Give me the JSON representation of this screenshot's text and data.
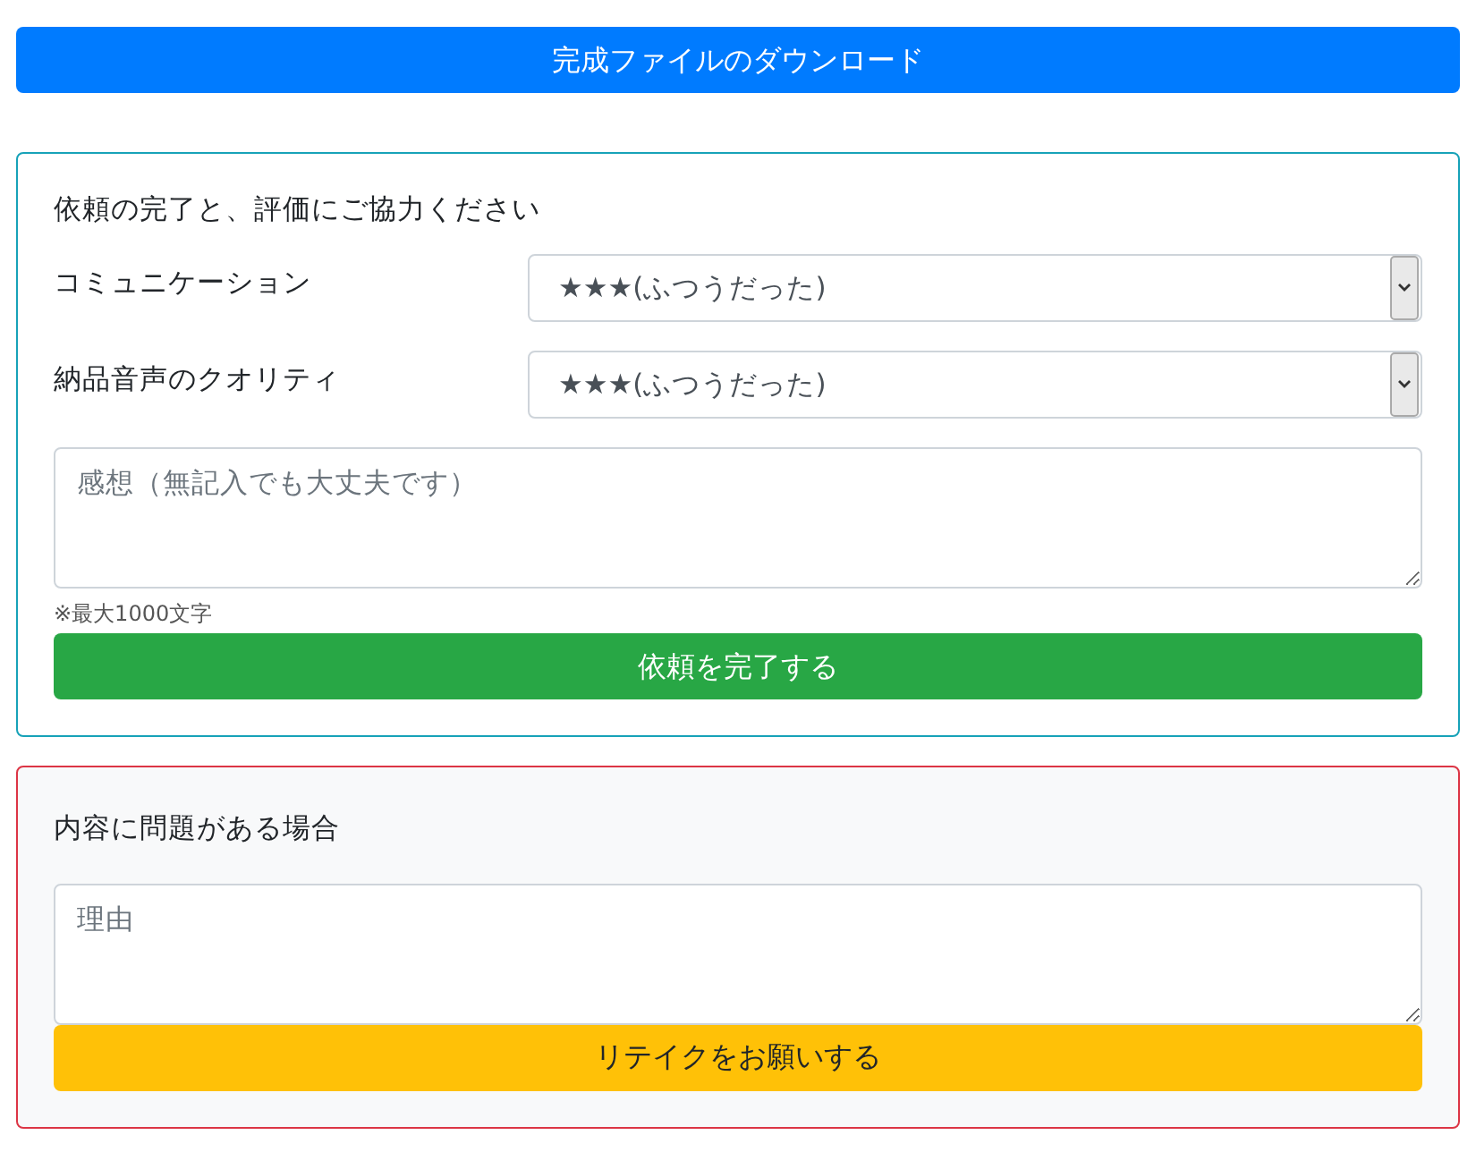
{
  "download_button": {
    "label": "完成ファイルのダウンロード"
  },
  "completion_form": {
    "title": "依頼の完了と、評価にご協力ください",
    "ratings": [
      {
        "label": "コミュニケーション",
        "value": "★★★(ふつうだった)"
      },
      {
        "label": "納品音声のクオリティ",
        "value": "★★★(ふつうだった)"
      }
    ],
    "comment": {
      "placeholder": "感想（無記入でも大丈夫です）"
    },
    "hint": "※最大1000文字",
    "submit_button": {
      "label": "依頼を完了する"
    }
  },
  "problem_form": {
    "title": "内容に問題がある場合",
    "reason": {
      "placeholder": "理由"
    },
    "retake_button": {
      "label": "リテイクをお願いする"
    }
  }
}
